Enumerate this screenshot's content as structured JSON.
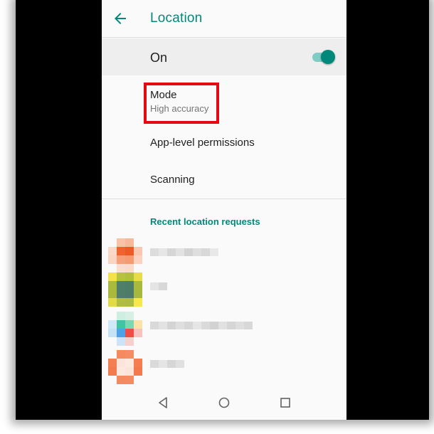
{
  "appbar": {
    "title": "Location",
    "back_icon": "arrow-back-icon"
  },
  "master_switch": {
    "label": "On",
    "checked": true
  },
  "mode": {
    "title": "Mode",
    "summary": "High accuracy"
  },
  "items": [
    {
      "label": "App-level permissions"
    },
    {
      "label": "Scanning"
    }
  ],
  "recent": {
    "header": "Recent location requests"
  },
  "navbar": {
    "icons": [
      "back-triangle-icon",
      "home-circle-icon",
      "recents-square-icon"
    ]
  },
  "colors": {
    "accent": "#00897b",
    "accent_light": "#80cbc4",
    "highlight": "#e50914",
    "text_primary": "#212121",
    "text_secondary": "#757575"
  }
}
